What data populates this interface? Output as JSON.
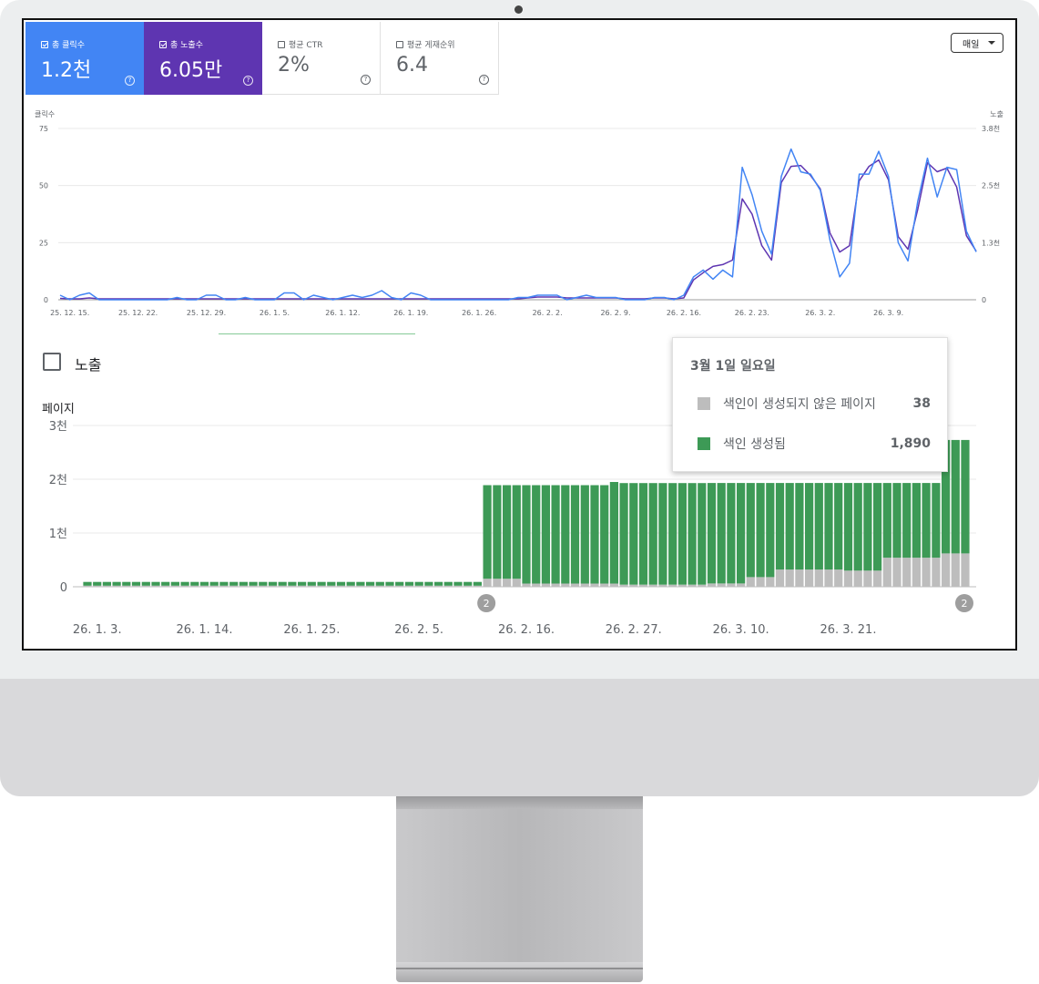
{
  "metrics": [
    {
      "label": "총 클릭수",
      "value": "1.2천",
      "checked": true
    },
    {
      "label": "총 노출수",
      "value": "6.05만",
      "checked": true
    },
    {
      "label": "평균 CTR",
      "value": "2%",
      "checked": false
    },
    {
      "label": "평균 게재순위",
      "value": "6.4",
      "checked": false
    }
  ],
  "period_select": {
    "value": "매일"
  },
  "colors": {
    "clicks": "#4285f4",
    "impressions": "#5e35b1",
    "indexed": "#3d9a56",
    "not_indexed": "#bdbdbd"
  },
  "performance_chart": {
    "left_axis_title": "클릭수",
    "right_axis_title": "노출",
    "left_ticks": [
      "75",
      "50",
      "25",
      "0"
    ],
    "right_ticks": [
      "3.8천",
      "2.5천",
      "1.3천",
      "0"
    ],
    "x_ticks": [
      "25. 12. 15.",
      "25. 12. 22.",
      "25. 12. 29.",
      "26. 1. 5.",
      "26. 1. 12.",
      "26. 1. 19.",
      "26. 1. 26.",
      "26. 2. 2.",
      "26. 2. 9.",
      "26. 2. 16.",
      "26. 2. 23.",
      "26. 3. 2.",
      "26. 3. 9."
    ]
  },
  "section": {
    "title": "노출"
  },
  "index_chart": {
    "y_title": "페이지",
    "y_ticks": [
      "3천",
      "2천",
      "1천",
      "0"
    ],
    "x_ticks": [
      "26. 1. 3.",
      "26. 1. 14.",
      "26. 1. 25.",
      "26. 2. 5.",
      "26. 2. 16.",
      "26. 2. 27.",
      "26. 3. 10.",
      "26. 3. 21."
    ],
    "annotations": [
      "2",
      "2"
    ]
  },
  "tooltip": {
    "title": "3월 1일 일요일",
    "rows": [
      {
        "label": "색인이 생성되지 않은 페이지",
        "value": "38"
      },
      {
        "label": "색인 생성됨",
        "value": "1,890"
      }
    ]
  },
  "chart_data": [
    {
      "type": "line",
      "title": "",
      "x_start": "25. 12. 14.",
      "x_step_days": 1,
      "ylabel": "클릭수",
      "ylim": [
        0,
        75
      ],
      "y2label": "노출",
      "y2lim": [
        0,
        3800
      ],
      "series": [
        {
          "name": "총 클릭수",
          "axis": "left",
          "values": [
            2,
            0,
            2,
            3,
            0,
            0,
            0,
            0,
            0,
            0,
            0,
            0,
            1,
            0,
            0,
            2,
            2,
            0,
            0,
            1,
            0,
            0,
            0,
            3,
            3,
            0,
            2,
            1,
            0,
            1,
            2,
            1,
            2,
            4,
            1,
            0,
            3,
            2,
            0,
            0,
            0,
            0,
            0,
            0,
            0,
            0,
            0,
            1,
            1,
            2,
            2,
            2,
            0,
            1,
            2,
            1,
            1,
            1,
            0,
            0,
            0,
            1,
            1,
            0,
            2,
            10,
            13,
            9,
            13,
            10,
            58,
            46,
            30,
            20,
            54,
            66,
            56,
            55,
            48,
            26,
            10,
            16,
            55,
            55,
            65,
            54,
            25,
            17,
            43,
            62,
            45,
            58,
            57,
            30,
            21
          ]
        },
        {
          "name": "총 노출수",
          "axis": "right",
          "values": [
            30,
            20,
            20,
            40,
            20,
            20,
            20,
            20,
            20,
            20,
            20,
            20,
            20,
            20,
            20,
            20,
            20,
            20,
            20,
            20,
            20,
            20,
            20,
            20,
            20,
            20,
            20,
            20,
            20,
            20,
            20,
            20,
            20,
            20,
            20,
            20,
            20,
            20,
            20,
            20,
            20,
            20,
            20,
            20,
            20,
            20,
            20,
            20,
            40,
            60,
            60,
            60,
            40,
            40,
            40,
            40,
            40,
            40,
            20,
            20,
            20,
            40,
            40,
            20,
            40,
            440,
            600,
            740,
            780,
            880,
            2240,
            1900,
            1200,
            880,
            2600,
            2960,
            2980,
            2760,
            2460,
            1480,
            1060,
            1200,
            2640,
            2960,
            3100,
            2660,
            1400,
            1120,
            2000,
            3040,
            2840,
            2920,
            2500,
            1420,
            1080
          ]
        }
      ]
    },
    {
      "type": "bar",
      "title": "",
      "stacked": true,
      "x_start": "26. 1. 2.",
      "x_step_days": 1,
      "ylabel": "페이지",
      "ylim": [
        0,
        3000
      ],
      "series": [
        {
          "name": "색인이 생성되지 않은 페이지",
          "values": [
            20,
            20,
            20,
            20,
            20,
            20,
            20,
            20,
            20,
            20,
            20,
            20,
            20,
            20,
            20,
            20,
            20,
            20,
            20,
            20,
            20,
            20,
            20,
            20,
            20,
            20,
            20,
            20,
            20,
            20,
            20,
            20,
            20,
            20,
            20,
            20,
            20,
            20,
            20,
            20,
            20,
            150,
            150,
            150,
            150,
            60,
            60,
            60,
            60,
            60,
            60,
            60,
            60,
            60,
            60,
            38,
            38,
            38,
            38,
            38,
            38,
            38,
            38,
            38,
            60,
            60,
            60,
            60,
            180,
            180,
            180,
            320,
            320,
            320,
            320,
            320,
            320,
            320,
            300,
            300,
            300,
            300,
            540,
            540,
            540,
            540,
            540,
            540,
            620,
            620,
            620
          ]
        },
        {
          "name": "색인 생성됨",
          "values": [
            70,
            70,
            70,
            70,
            70,
            70,
            70,
            70,
            70,
            70,
            70,
            70,
            70,
            70,
            70,
            70,
            70,
            70,
            70,
            70,
            70,
            70,
            70,
            70,
            70,
            70,
            70,
            70,
            70,
            70,
            70,
            70,
            70,
            70,
            70,
            70,
            70,
            70,
            70,
            70,
            70,
            1740,
            1740,
            1740,
            1740,
            1830,
            1830,
            1830,
            1830,
            1830,
            1830,
            1830,
            1830,
            1830,
            1890,
            1890,
            1890,
            1890,
            1890,
            1890,
            1890,
            1890,
            1890,
            1890,
            1870,
            1870,
            1870,
            1870,
            1750,
            1750,
            1750,
            1610,
            1610,
            1610,
            1610,
            1610,
            1610,
            1610,
            1630,
            1630,
            1630,
            1630,
            1390,
            1390,
            1390,
            1390,
            1390,
            1390,
            2110,
            2110,
            2110
          ]
        }
      ]
    }
  ]
}
